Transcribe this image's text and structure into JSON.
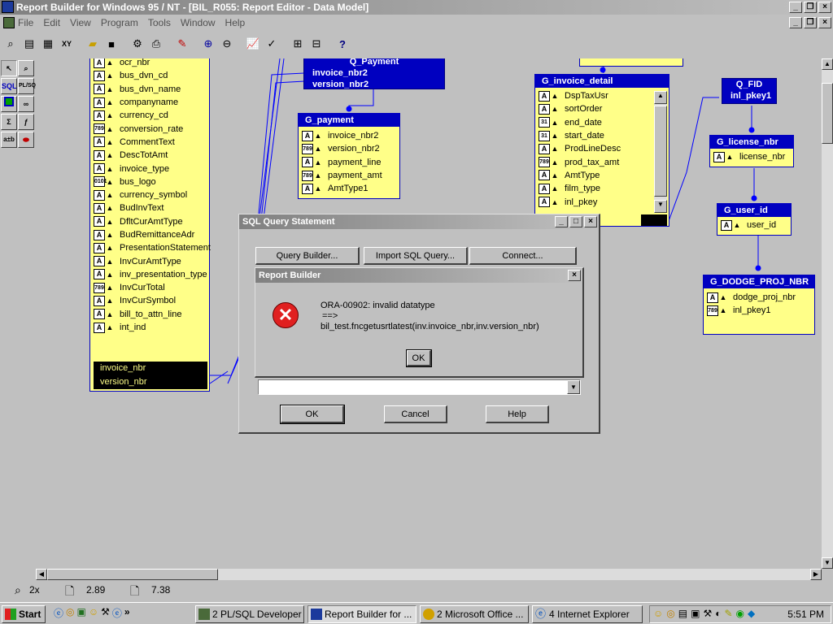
{
  "window": {
    "title": "Report Builder for Windows 95 / NT - [BIL_R055: Report Editor - Data Model]"
  },
  "menu": [
    "File",
    "Edit",
    "View",
    "Program",
    "Tools",
    "Window",
    "Help"
  ],
  "groups": {
    "main_items": [
      {
        "t": "A",
        "n": "ocr_nbr"
      },
      {
        "t": "A",
        "n": "bus_dvn_cd"
      },
      {
        "t": "A",
        "n": "bus_dvn_name"
      },
      {
        "t": "A",
        "n": "companyname"
      },
      {
        "t": "A",
        "n": "currency_cd"
      },
      {
        "t": "789",
        "n": "conversion_rate"
      },
      {
        "t": "A",
        "n": "CommentText"
      },
      {
        "t": "A",
        "n": "DescTotAmt"
      },
      {
        "t": "A",
        "n": "invoice_type"
      },
      {
        "t": "0101",
        "n": "bus_logo"
      },
      {
        "t": "A",
        "n": "currency_symbol"
      },
      {
        "t": "A",
        "n": "BudInvText"
      },
      {
        "t": "A",
        "n": "DfltCurAmtType"
      },
      {
        "t": "A",
        "n": "BudRemittanceAdr"
      },
      {
        "t": "A",
        "n": "PresentationStatement"
      },
      {
        "t": "A",
        "n": "InvCurAmtType"
      },
      {
        "t": "A",
        "n": "inv_presentation_type"
      },
      {
        "t": "789",
        "n": "InvCurTotal"
      },
      {
        "t": "A",
        "n": "InvCurSymbol"
      },
      {
        "t": "A",
        "n": "bill_to_attn_line"
      },
      {
        "t": "A",
        "n": "int_ind"
      }
    ],
    "main_footer": [
      "invoice_nbr",
      "version_nbr"
    ],
    "q_payment": {
      "title": "Q_Payment",
      "lines": [
        "invoice_nbr2",
        "version_nbr2"
      ]
    },
    "g_payment": {
      "title": "G_payment",
      "items": [
        {
          "t": "A",
          "n": "invoice_nbr2"
        },
        {
          "t": "789",
          "n": "version_nbr2"
        },
        {
          "t": "A",
          "n": "payment_line"
        },
        {
          "t": "789",
          "n": "payment_amt"
        },
        {
          "t": "A",
          "n": "AmtType1"
        }
      ]
    },
    "g_invoice_detail": {
      "title": "G_invoice_detail",
      "items": [
        {
          "t": "A",
          "n": "DspTaxUsr"
        },
        {
          "t": "A",
          "n": "sortOrder"
        },
        {
          "t": "31",
          "n": "end_date"
        },
        {
          "t": "31",
          "n": "start_date"
        },
        {
          "t": "A",
          "n": "ProdLineDesc"
        },
        {
          "t": "789",
          "n": "prod_tax_amt"
        },
        {
          "t": "A",
          "n": "AmtType"
        },
        {
          "t": "A",
          "n": "film_type"
        },
        {
          "t": "A",
          "n": "inl_pkey"
        }
      ]
    },
    "q_fid": {
      "title": "Q_FID",
      "lines": [
        "inl_pkey1"
      ]
    },
    "g_license_nbr": {
      "title": "G_license_nbr",
      "items": [
        {
          "t": "A",
          "n": "license_nbr"
        }
      ]
    },
    "g_user_id": {
      "title": "G_user_id",
      "items": [
        {
          "t": "A",
          "n": "user_id"
        }
      ]
    },
    "g_dodge": {
      "title": "G_DODGE_PROJ_NBR",
      "items": [
        {
          "t": "A",
          "n": "dodge_proj_nbr"
        },
        {
          "t": "789",
          "n": "inl_pkey1"
        }
      ]
    }
  },
  "sql_dialog": {
    "title": "SQL Query Statement",
    "query_builder": "Query Builder...",
    "import_sql": "Import SQL Query...",
    "connect": "Connect...",
    "ok": "OK",
    "cancel": "Cancel",
    "help": "Help"
  },
  "error_dialog": {
    "title": "Report Builder",
    "line1": "ORA-00902: invalid datatype",
    "line2": "==>",
    "line3": "bil_test.fncgetusrtlatest(inv.invoice_nbr,inv.version_nbr)",
    "ok": "OK"
  },
  "status": {
    "zoom": "2x",
    "x": "2.89",
    "y": "7.38"
  },
  "taskbar": {
    "start": "Start",
    "tasks": [
      "2 PL/SQL Developer",
      "Report Builder for ...",
      "2 Microsoft Office ...",
      "4 Internet Explorer"
    ],
    "clock": "5:51 PM"
  },
  "colors": {
    "group_fill": "#ffff88",
    "group_header": "#0000c0",
    "error_icon": "#e02020"
  }
}
